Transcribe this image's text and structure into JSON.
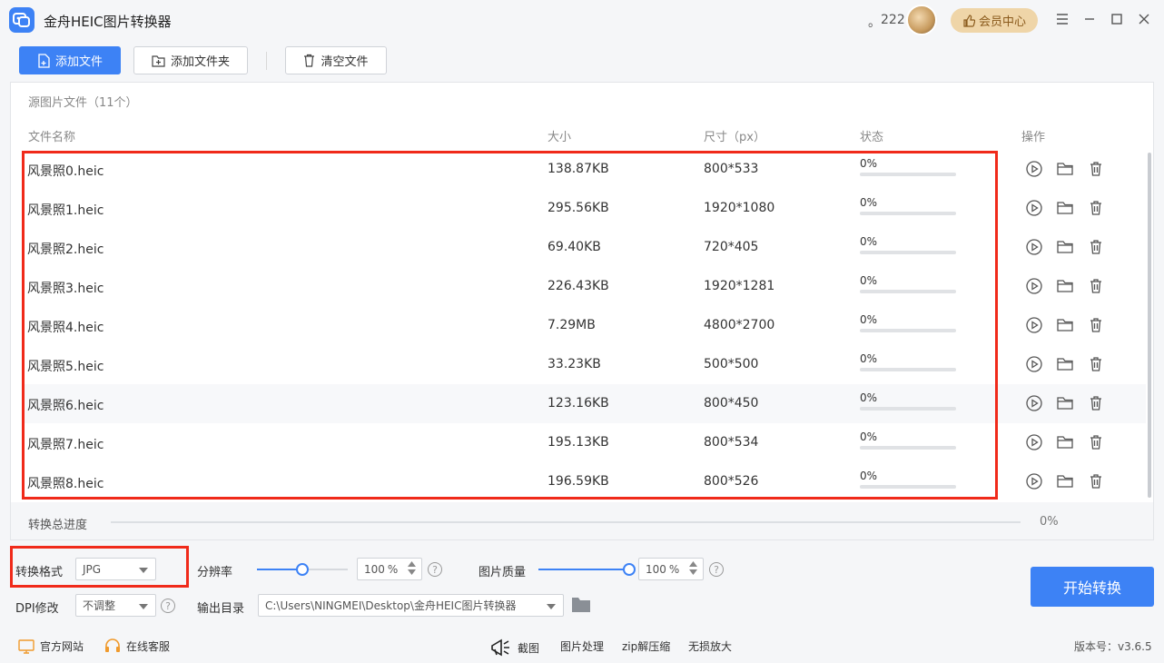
{
  "app": {
    "title": "金舟HEIC图片转换器",
    "user_dot": "。",
    "user_name": "222",
    "vip_label": "会员中心"
  },
  "toolbar": {
    "add_file": "添加文件",
    "add_folder": "添加文件夹",
    "clear_files": "清空文件"
  },
  "source": {
    "title": "源图片文件（11个）"
  },
  "table": {
    "headers": {
      "name": "文件名称",
      "size": "大小",
      "dimension": "尺寸（px）",
      "status": "状态",
      "actions": "操作"
    },
    "rows": [
      {
        "name": "风景照0.heic",
        "size": "138.87KB",
        "dimension": "800*533",
        "status": "0%",
        "progress": 0
      },
      {
        "name": "风景照1.heic",
        "size": "295.56KB",
        "dimension": "1920*1080",
        "status": "0%",
        "progress": 0
      },
      {
        "name": "风景照2.heic",
        "size": "69.40KB",
        "dimension": "720*405",
        "status": "0%",
        "progress": 0
      },
      {
        "name": "风景照3.heic",
        "size": "226.43KB",
        "dimension": "1920*1281",
        "status": "0%",
        "progress": 0
      },
      {
        "name": "风景照4.heic",
        "size": "7.29MB",
        "dimension": "4800*2700",
        "status": "0%",
        "progress": 0
      },
      {
        "name": "风景照5.heic",
        "size": "33.23KB",
        "dimension": "500*500",
        "status": "0%",
        "progress": 0
      },
      {
        "name": "风景照6.heic",
        "size": "123.16KB",
        "dimension": "800*450",
        "status": "0%",
        "progress": 0
      },
      {
        "name": "风景照7.heic",
        "size": "195.13KB",
        "dimension": "800*534",
        "status": "0%",
        "progress": 0
      },
      {
        "name": "风景照8.heic",
        "size": "196.59KB",
        "dimension": "800*526",
        "status": "0%",
        "progress": 0
      }
    ]
  },
  "progress": {
    "label": "转换总进度",
    "value_text": "0%",
    "value": 0
  },
  "settings": {
    "format_label": "转换格式",
    "format_value": "JPG",
    "resolution_label": "分辨率",
    "resolution_value": "100",
    "resolution_unit": "%",
    "resolution_level": 0.5,
    "quality_label": "图片质量",
    "quality_value": "100",
    "quality_unit": "%",
    "quality_level": 1.0,
    "dpi_label": "DPI修改",
    "dpi_value": "不调整",
    "output_label": "输出目录",
    "output_path": "C:\\Users\\NINGMEI\\Desktop\\金舟HEIC图片转换器",
    "help_glyph": "?",
    "start_button": "开始转换"
  },
  "footer": {
    "website": "官方网站",
    "support": "在线客服",
    "screenshot": "截图",
    "image_process": "图片处理",
    "zip": "zip解压缩",
    "upscale": "无损放大",
    "version": "版本号：v3.6.5"
  },
  "colors": {
    "accent": "#3d82f5",
    "highlight": "#f02a1a",
    "vip_bg": "#efd5a8"
  }
}
